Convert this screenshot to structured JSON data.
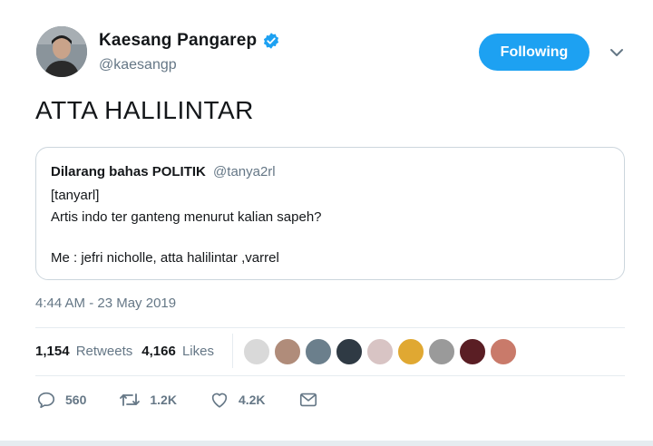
{
  "author": {
    "display_name": "Kaesang Pangarep",
    "handle": "@kaesangp",
    "verified": true
  },
  "follow_button": {
    "label": "Following",
    "color": "#1da1f2"
  },
  "tweet": {
    "text": "ATTA HALILINTAR"
  },
  "quoted_tweet": {
    "display_name": "Dilarang bahas POLITIK",
    "handle": "@tanya2rl",
    "lines": [
      "[tanyarl]",
      "Artis indo ter ganteng menurut kalian sapeh?",
      "",
      "Me : jefri nicholle, atta halilintar ,varrel"
    ]
  },
  "timestamp": "4:44 AM - 23 May 2019",
  "stats": {
    "retweets_count": "1,154",
    "retweets_label": "Retweets",
    "likes_count": "4,166",
    "likes_label": "Likes"
  },
  "likers": [
    {
      "color": "#d9d9d9"
    },
    {
      "color": "#b08c7a"
    },
    {
      "color": "#6b7f8c"
    },
    {
      "color": "#2f3a44"
    },
    {
      "color": "#d8c4c4"
    },
    {
      "color": "#e0a832"
    },
    {
      "color": "#9a9a9a"
    },
    {
      "color": "#5a1e24"
    },
    {
      "color": "#c97a6a"
    }
  ],
  "actions": {
    "reply_count": "560",
    "retweet_count": "1.2K",
    "like_count": "4.2K"
  },
  "colors": {
    "accent": "#1da1f2",
    "verified": "#1da1f2",
    "secondary_text": "#657786",
    "border": "#e6ecf0"
  },
  "icons": [
    "verified-badge-icon",
    "chevron-down-icon",
    "reply-icon",
    "retweet-icon",
    "like-icon",
    "message-icon"
  ]
}
